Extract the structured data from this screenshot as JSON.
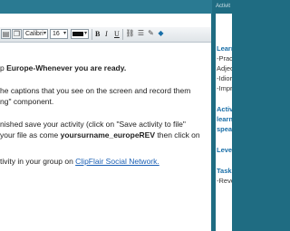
{
  "toolbar": {
    "font_name": "Calibri",
    "font_size": "16",
    "bold": "B",
    "italic": "I",
    "underline": "U"
  },
  "content": {
    "line1_prefix": "p ",
    "line1_bold": "Europe-Whenever you are ready",
    "line1_suffix": ".",
    "line2": "he captions that you see on the screen and record them",
    "line3": "ng\" component.",
    "line4": "nished save your activity (click on \"Save activity to file\"",
    "line5_prefix": "your file as come ",
    "line5_bold": "yoursurname_europeREV",
    "line5_suffix": " then click on",
    "line6_prefix": "tivity in your group on ",
    "line6_link": "ClipFlair Social Network."
  },
  "sidebar": {
    "header": "Activit",
    "items": [
      {
        "text": "Learn",
        "kind": "heading"
      },
      {
        "text": "-Pract",
        "kind": "item"
      },
      {
        "text": "Adjec",
        "kind": "item"
      },
      {
        "text": "-Idior",
        "kind": "item"
      },
      {
        "text": "-Impr",
        "kind": "item"
      },
      {
        "text": "Activ",
        "kind": "heading"
      },
      {
        "text": "learn",
        "kind": "heading"
      },
      {
        "text": "speal",
        "kind": "heading"
      },
      {
        "text": "Level",
        "kind": "heading"
      },
      {
        "text": "Task",
        "kind": "heading"
      },
      {
        "text": "-Revo",
        "kind": "item"
      }
    ]
  },
  "colors": {
    "frame": "#1f6c82",
    "link": "#1a5fb4",
    "heading": "#1a6fa8"
  }
}
